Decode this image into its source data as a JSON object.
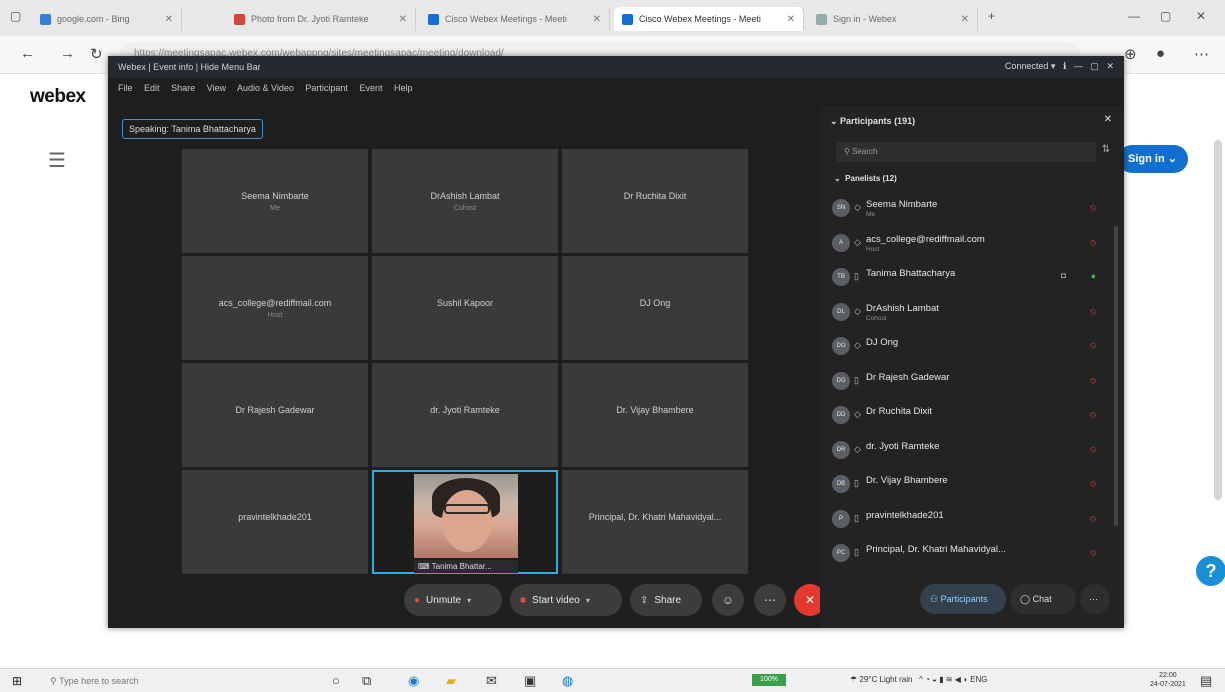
{
  "browser": {
    "tabs": [
      {
        "label": "google.com - Bing",
        "color": "#3a7bd5"
      },
      {
        "label": "Photo from Dr. Jyoti Ramteke",
        "color": "#d44638"
      },
      {
        "label": "Cisco Webex Meetings - Meeti",
        "color": "#1170cf"
      },
      {
        "label": "Cisco Webex Meetings - Meeti",
        "color": "#1170cf"
      },
      {
        "label": "Sign in - Webex",
        "color": "#9aa"
      }
    ],
    "url": "https://meetingsapac.webex.com/webappng/sites/meetingsapac/meeting/download/"
  },
  "site": {
    "logo": "webex",
    "sign_in": "Sign in"
  },
  "meeting": {
    "title": "Webex | Event info | Hide Menu Bar",
    "status": "Connected",
    "menu": [
      "File",
      "Edit",
      "Share",
      "View",
      "Audio & Video",
      "Participant",
      "Event",
      "Help"
    ],
    "speaking": "Speaking: Tanima Bhattacharya",
    "tiles": [
      {
        "name": "Seema Nimbarte",
        "sub": "Me"
      },
      {
        "name": "DrAshish Lambat",
        "sub": "Cohost"
      },
      {
        "name": "Dr Ruchita Dixit",
        "sub": ""
      },
      {
        "name": "acs_college@rediffmail.com",
        "sub": "Host"
      },
      {
        "name": "Sushil Kapoor",
        "sub": ""
      },
      {
        "name": "DJ Ong",
        "sub": ""
      },
      {
        "name": "Dr Rajesh Gadewar",
        "sub": ""
      },
      {
        "name": "dr. Jyoti Ramteke",
        "sub": ""
      },
      {
        "name": "Dr. Vijay Bhambere",
        "sub": ""
      },
      {
        "name": "pravintelkhade201",
        "sub": ""
      },
      {
        "name": "Tanima Bhattar...",
        "sub": ""
      },
      {
        "name": "Principal, Dr. Khatri Mahavidyal...",
        "sub": ""
      }
    ],
    "controls": {
      "unmute": "Unmute",
      "start_video": "Start video",
      "share": "Share",
      "participants": "Participants",
      "chat": "Chat"
    }
  },
  "participants_panel": {
    "title": "Participants (191)",
    "search_placeholder": "Search",
    "panelists_header": "Panelists (12)",
    "panelists": [
      {
        "initials": "SN",
        "name": "Seema Nimbarte",
        "role": "Me"
      },
      {
        "initials": "A",
        "name": "acs_college@rediffmail.com",
        "role": "Host"
      },
      {
        "initials": "TB",
        "name": "Tanima Bhattacharya",
        "role": ""
      },
      {
        "initials": "DL",
        "name": "DrAshish Lambat",
        "role": "Cohost"
      },
      {
        "initials": "DO",
        "name": "DJ Ong",
        "role": ""
      },
      {
        "initials": "DG",
        "name": "Dr Rajesh Gadewar",
        "role": ""
      },
      {
        "initials": "DD",
        "name": "Dr Ruchita Dixit",
        "role": ""
      },
      {
        "initials": "DR",
        "name": "dr. Jyoti Ramteke",
        "role": ""
      },
      {
        "initials": "DB",
        "name": "Dr. Vijay Bhambere",
        "role": ""
      },
      {
        "initials": "P",
        "name": "pravintelkhade201",
        "role": ""
      },
      {
        "initials": "PC",
        "name": "Principal, Dr. Khatri Mahavidyal...",
        "role": ""
      }
    ]
  },
  "taskbar": {
    "search": "Type here to search",
    "battery": "100%",
    "weather": "29°C  Light rain",
    "lang": "ENG",
    "time": "22:00",
    "date": "24-07-2021"
  }
}
